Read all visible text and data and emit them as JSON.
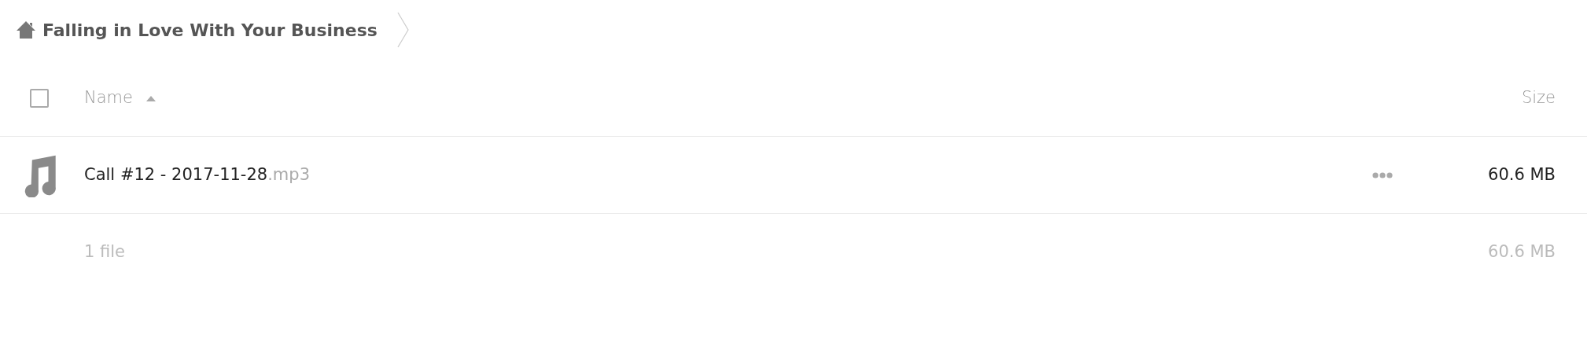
{
  "breadcrumb": {
    "title": "Falling in Love With Your Business"
  },
  "header": {
    "select_all": {
      "checked": false
    },
    "name_label": "Name",
    "sort_ascending": true,
    "size_label": "Size"
  },
  "files": [
    {
      "kind": "audio",
      "basename": "Call #12 - 2017-11-28",
      "extension": ".mp3",
      "size": "60.6 MB",
      "selected": false
    }
  ],
  "summary": {
    "count": "1 file",
    "size": "60.6 MB"
  }
}
